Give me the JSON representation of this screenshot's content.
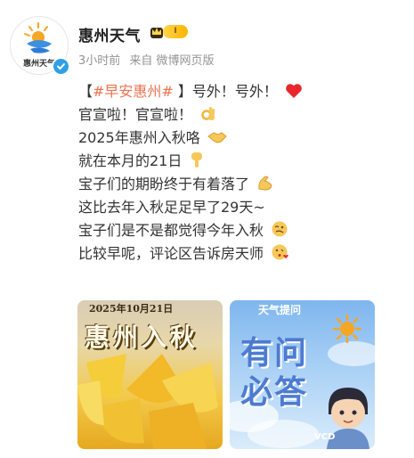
{
  "account": {
    "name": "惠州天气",
    "avatar_caption": "惠州天气",
    "vip_label": "I"
  },
  "meta": {
    "time": "3小时前",
    "source": "来自 微博网页版"
  },
  "post": {
    "line1": {
      "open": "【",
      "topic": "#早安惠州#",
      "close": " 】号外！号外！"
    },
    "line2": "官宣啦！官宣啦！",
    "line3": "2025年惠州入秋咯",
    "line4": "就在本月的21日",
    "line5": "宝子们的期盼终于有着落了",
    "line6": "这比去年入秋足足早了29天~",
    "line7": "宝子们是不是都觉得今年入秋",
    "line8": "比较早呢，评论区告诉房天师"
  },
  "images": [
    {
      "date": "2025年10月21日",
      "title": "惠州入秋"
    },
    {
      "top": "天气提问",
      "big1": "有问",
      "big2": "必答",
      "watermark": "VCD"
    }
  ],
  "colors": {
    "topic": "#eb7350",
    "verified": "#2f9fe8",
    "meta": "#939393"
  }
}
